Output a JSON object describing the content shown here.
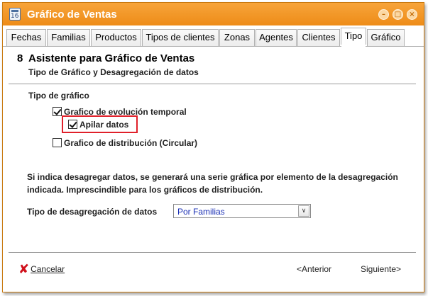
{
  "window": {
    "title": "Gráfico de Ventas",
    "icon": "calendar-app-icon",
    "icon_text": "16",
    "controls": {
      "minimize": "–",
      "maximize": "□",
      "close": "×"
    }
  },
  "tabs": [
    {
      "label": "Fechas"
    },
    {
      "label": "Familias"
    },
    {
      "label": "Productos"
    },
    {
      "label": "Tipos de clientes"
    },
    {
      "label": "Zonas"
    },
    {
      "label": "Agentes"
    },
    {
      "label": "Clientes"
    },
    {
      "label": "Tipo",
      "active": true
    },
    {
      "label": "Gráfico"
    }
  ],
  "wizard": {
    "step": "8",
    "title": "Asistente para Gráfico de Ventas",
    "subtitle": "Tipo de Gráfico y Desagregación de datos"
  },
  "chart_type": {
    "section_label": "Tipo de gráfico",
    "options": [
      {
        "label": "Grafico de evolución temporal",
        "checked": true
      },
      {
        "label": "Apilar datos",
        "checked": true,
        "highlighted": true
      },
      {
        "label": "Grafico de distribución (Circular)",
        "checked": false
      }
    ]
  },
  "info_text": "Si indica desagregar datos, se generará una serie gráfica por elemento de la desagregación indicada. Imprescindible para los gráficos de distribución.",
  "disaggregation": {
    "label": "Tipo de desagregación de datos",
    "selected": "Por Familias",
    "arrow": "∨"
  },
  "footer": {
    "cancel_label": "Cancelar",
    "cancel_icon": "red-x-icon",
    "prev_label": "<Anterior",
    "next_label": "Siguiente>"
  },
  "colors": {
    "titlebar": "#f39a26",
    "highlight_border": "#e0202a",
    "select_text": "#1a2fb5"
  }
}
